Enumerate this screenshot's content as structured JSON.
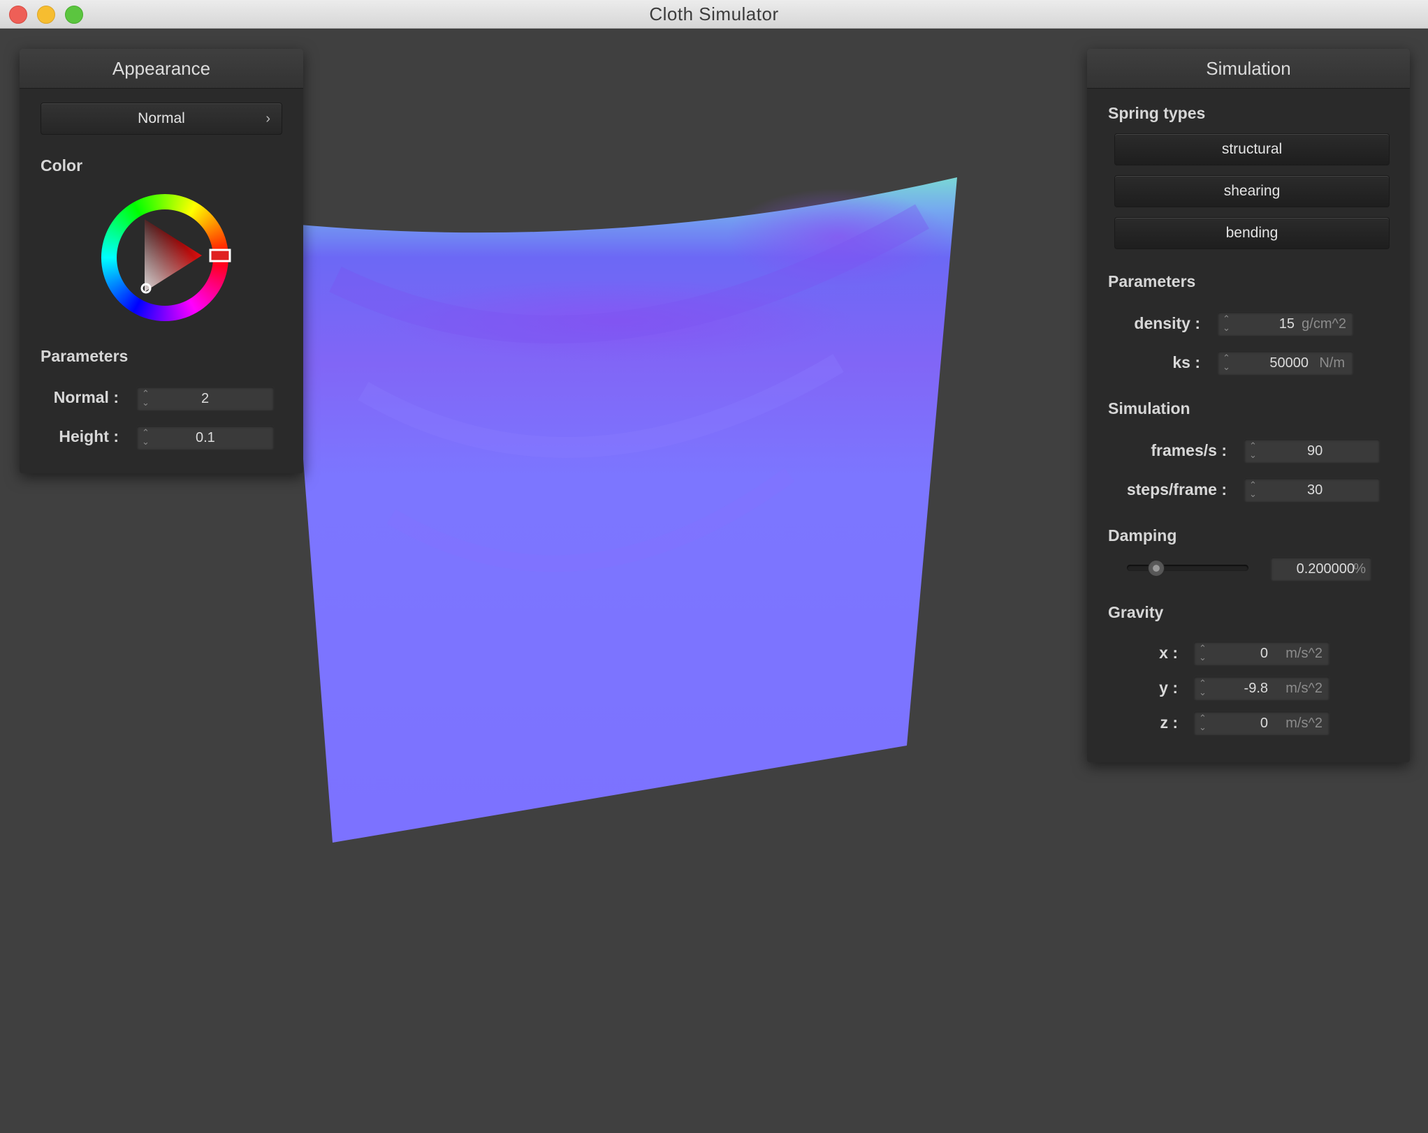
{
  "window": {
    "title": "Cloth Simulator"
  },
  "appearance": {
    "title": "Appearance",
    "shader": "Normal",
    "color_label": "Color",
    "parameters_label": "Parameters",
    "normal_label": "Normal :",
    "normal_value": "2",
    "height_label": "Height :",
    "height_value": "0.1",
    "selected_color": "#e02020"
  },
  "simulation": {
    "title": "Simulation",
    "spring_types_label": "Spring types",
    "springs": [
      "structural",
      "shearing",
      "bending"
    ],
    "parameters_label": "Parameters",
    "density_label": "density :",
    "density_value": "15",
    "density_unit": "g/cm^2",
    "ks_label": "ks :",
    "ks_value": "50000",
    "ks_unit": "N/m",
    "sim_label": "Simulation",
    "fps_label": "frames/s :",
    "fps_value": "90",
    "steps_label": "steps/frame :",
    "steps_value": "30",
    "damping_label": "Damping",
    "damping_value": "0.200000",
    "damping_unit": "%",
    "damping_slider_fraction": 0.2,
    "gravity_label": "Gravity",
    "gx_label": "x :",
    "gx_value": "0",
    "gy_label": "y :",
    "gy_value": "-9.8",
    "gz_label": "z :",
    "gz_value": "0",
    "gravity_unit": "m/s^2"
  },
  "colors": {
    "cloth_base": "#7b74ff",
    "cloth_fold": "#8a4ff2",
    "cloth_edge": "#7ad7d5",
    "background": "#404040",
    "panel": "#2a2a2a"
  }
}
